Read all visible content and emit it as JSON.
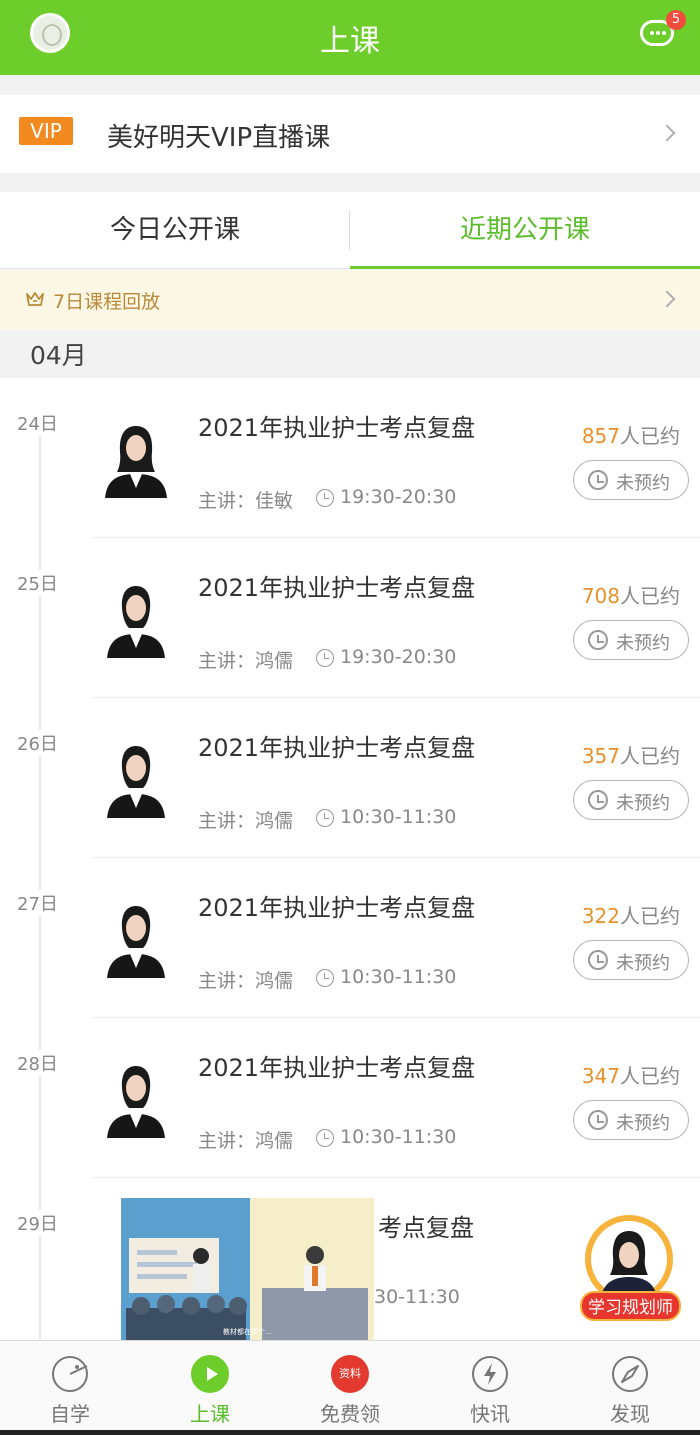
{
  "header": {
    "title": "上课",
    "message_badge": "5",
    "avatar_icon": "user-avatar-icon",
    "message_icon": "chat-bubble-icon",
    "accent_color": "#6dcd2b"
  },
  "vip": {
    "tag": "VIP",
    "title": "美好明天VIP直播课"
  },
  "tabs": [
    {
      "label": "今日公开课",
      "active": false
    },
    {
      "label": "近期公开课",
      "active": true
    }
  ],
  "replay": {
    "label": "7日课程回放"
  },
  "month": "04月",
  "courses": [
    {
      "day": "24日",
      "title": "2021年执业护士考点复盘",
      "teacher": "主讲：佳敏",
      "time": "19:30-20:30",
      "count": "857",
      "count_suffix": "人已约",
      "status": "未预约"
    },
    {
      "day": "25日",
      "title": "2021年执业护士考点复盘",
      "teacher": "主讲：鸿儒",
      "time": "19:30-20:30",
      "count": "708",
      "count_suffix": "人已约",
      "status": "未预约"
    },
    {
      "day": "26日",
      "title": "2021年执业护士考点复盘",
      "teacher": "主讲：鸿儒",
      "time": "10:30-11:30",
      "count": "357",
      "count_suffix": "人已约",
      "status": "未预约"
    },
    {
      "day": "27日",
      "title": "2021年执业护士考点复盘",
      "teacher": "主讲：鸿儒",
      "time": "10:30-11:30",
      "count": "322",
      "count_suffix": "人已约",
      "status": "未预约"
    },
    {
      "day": "28日",
      "title": "2021年执业护士考点复盘",
      "teacher": "主讲：鸿儒",
      "time": "10:30-11:30",
      "count": "347",
      "count_suffix": "人已约",
      "status": "未预约"
    },
    {
      "day": "29日",
      "title_partial": "考点复盘",
      "time_partial": "30-11:30"
    }
  ],
  "float_ad": {
    "caption": "教材都在那个…"
  },
  "planner": {
    "label": "学习规划师"
  },
  "bottom_nav": [
    {
      "label": "自学",
      "icon": "pacman-face-icon",
      "active": false
    },
    {
      "label": "上课",
      "icon": "play-icon",
      "active": true
    },
    {
      "label": "免费领",
      "icon": "gift-badge-icon",
      "badge": "资料",
      "active": false
    },
    {
      "label": "快讯",
      "icon": "lightning-icon",
      "active": false
    },
    {
      "label": "发现",
      "icon": "compass-icon",
      "active": false
    }
  ]
}
